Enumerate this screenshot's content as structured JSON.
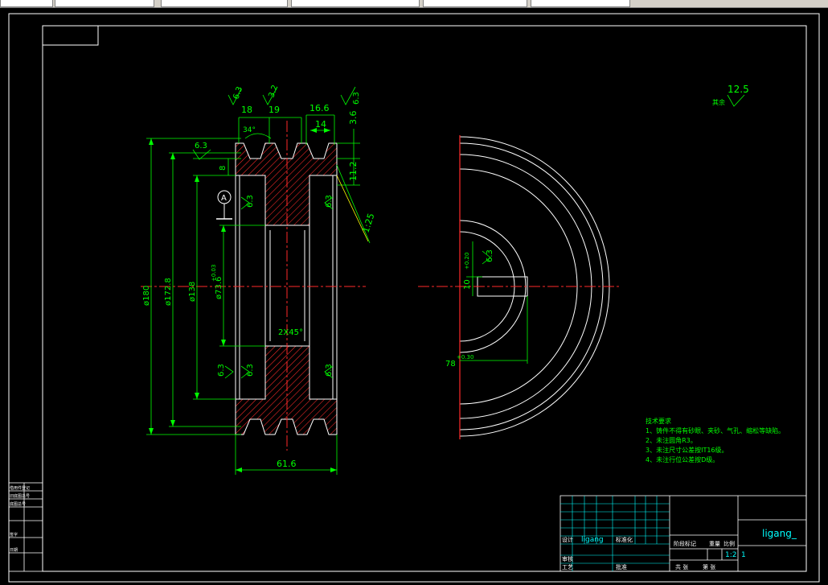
{
  "drawing": {
    "colors": {
      "background": "#000000",
      "outline": "#ffffff",
      "dimension": "#00ff00",
      "centerline": "#ff0000",
      "hatch": "#ff2a2a",
      "leader": "#ffff00",
      "title_text": "#00ffff"
    },
    "section_view": {
      "dims": {
        "top_18": "18",
        "top_19": "19",
        "top_16_6": "16.6",
        "top_14": "14",
        "angle_34": "34°",
        "right_3_6": "3.6",
        "right_11_2": "11.2",
        "taper": "1:25",
        "left_8": "8",
        "dia_180": "ø180",
        "dia_172_8": "ø172.8",
        "dia_138": "ø138",
        "dia_73_6": "ø73.6",
        "dia_73_6_tol": "+0.03",
        "chamfer": "2X45°",
        "width_61_6": "61.6"
      },
      "roughness": [
        "6.3",
        "3.2",
        "6.3",
        "6.3",
        "6.3",
        "6.3",
        "6.3",
        "6.3",
        "6.3"
      ],
      "datum": "A"
    },
    "end_view": {
      "dims": {
        "keyway_depth": "10",
        "keyway_depth_tol": "+0.20",
        "keyway_rough": "6.3",
        "hub_dim": "78",
        "hub_dim_tol": "+0.30"
      }
    },
    "general_roughness": {
      "label": "其余",
      "value": "12.5"
    },
    "tech_requirements": {
      "title": "技术要求",
      "items": [
        "1、铸件不得有砂眼、夹砂、气孔、缩松等缺陷。",
        "2、未注圆角R3。",
        "3、未注尺寸公差按IT16级。",
        "4、未注行位公差按D级。"
      ]
    },
    "title_block": {
      "designer": "ligang",
      "drawing_name": "ligang_",
      "scale": "1:2",
      "sheet": "1",
      "labels": {
        "designed": "设计",
        "standardized": "标准化",
        "checked": "审核",
        "process": "工艺",
        "approved": "批准",
        "stage_mark": "阶段标记",
        "weight": "重量",
        "ratio": "比例",
        "total_sheets": "共 张",
        "sheet_no": "第 张"
      }
    },
    "side_table": {
      "rows": [
        "借用件登记",
        "旧底图总号",
        "底图总号",
        "签字",
        "日期"
      ]
    }
  }
}
